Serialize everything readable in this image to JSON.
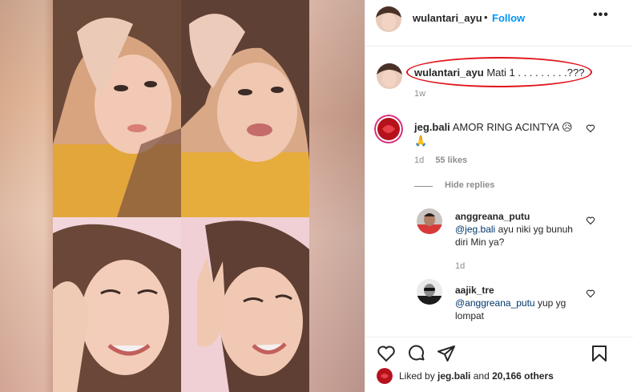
{
  "post": {
    "username": "wulantari_ayu",
    "separator": "•",
    "follow_label": "Follow",
    "more_label": "•••"
  },
  "caption": {
    "username": "wulantari_ayu",
    "text": "Mati 1 . . . . . . . . .???",
    "time": "1w"
  },
  "comments": [
    {
      "username": "jeg.bali",
      "text": "AMOR RING ACINTYA 😥🙏",
      "time": "1d",
      "likes": "55 likes",
      "hide_replies": "Hide replies",
      "replies": [
        {
          "username": "anggreana_putu",
          "mention": "@jeg.bali",
          "text": "ayu niki yg bunuh diri Min ya?",
          "time": "1d"
        },
        {
          "username": "aajik_tre",
          "mention": "@anggreana_putu",
          "text": "yup yg lompat"
        }
      ]
    }
  ],
  "likes_line": {
    "prefix": "Liked by",
    "user": "jeg.bali",
    "middle": "and",
    "count": "20,166 others"
  },
  "colors": {
    "follow": "#0095f6",
    "highlight": "#e0141b",
    "mention": "#00376b",
    "muted": "#8e8e8e"
  },
  "icons": [
    "more-options-icon",
    "heart-icon",
    "comment-icon",
    "share-icon",
    "bookmark-icon"
  ]
}
